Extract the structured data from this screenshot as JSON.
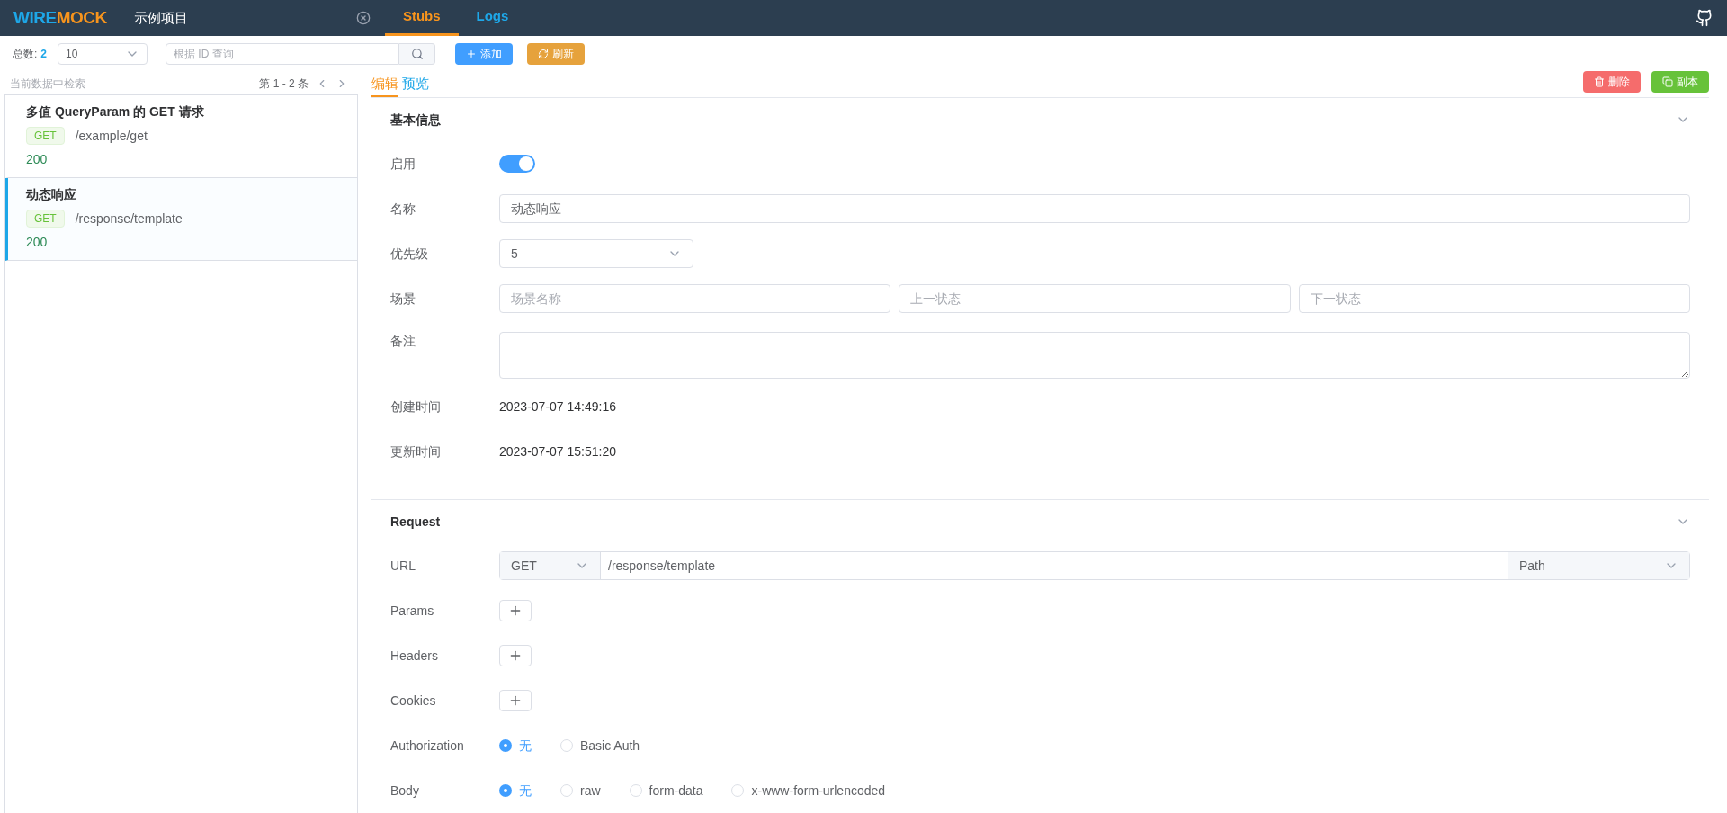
{
  "header": {
    "logo": {
      "first": "WIRE",
      "second": "MOCK"
    },
    "project": "示例项目",
    "tabs": [
      {
        "label": "Stubs",
        "selected": true
      },
      {
        "label": "Logs",
        "selected": false
      }
    ]
  },
  "toolbar": {
    "total_label": "总数:",
    "total": "2",
    "page_size": "10",
    "search": {
      "placeholder": "根据 ID 查询"
    },
    "buttons": [
      {
        "kind": "add",
        "label": "添加"
      },
      {
        "kind": "refresh",
        "label": "刷新"
      }
    ]
  },
  "list": {
    "filter_hint": "当前数据中检索",
    "range": "第 1 - 2 条",
    "items": [
      {
        "title": "多值 QueryParam 的 GET 请求",
        "method": "GET",
        "path": "/example/get",
        "status": "200",
        "selected": false
      },
      {
        "title": "动态响应",
        "method": "GET",
        "path": "/response/template",
        "status": "200",
        "selected": true
      }
    ]
  },
  "detail": {
    "tabs": [
      {
        "label": "编辑",
        "selected": true
      },
      {
        "label": "预览",
        "selected": false
      }
    ],
    "actions": [
      {
        "kind": "delete",
        "label": "删除"
      },
      {
        "kind": "copy",
        "label": "副本"
      }
    ],
    "basic": {
      "title": "基本信息",
      "expanded": true,
      "rows": [
        {
          "kind": "switch",
          "label": "启用",
          "on": true
        },
        {
          "kind": "input",
          "label": "名称",
          "value": "动态响应"
        },
        {
          "kind": "select",
          "label": "优先级",
          "value": "5"
        },
        {
          "kind": "inputs",
          "label": "场景",
          "placeholders": [
            "场景名称",
            "上一状态",
            "下一状态"
          ]
        },
        {
          "kind": "textarea",
          "label": "备注"
        },
        {
          "kind": "text",
          "label": "创建时间",
          "value": "2023-07-07 14:49:16"
        },
        {
          "kind": "text",
          "label": "更新时间",
          "value": "2023-07-07 15:51:20"
        }
      ]
    },
    "request": {
      "title": "Request",
      "expanded": true,
      "rows": [
        {
          "kind": "url",
          "label": "URL",
          "method": "GET",
          "value": "/response/template",
          "match": "Path"
        },
        {
          "kind": "add",
          "label": "Params"
        },
        {
          "kind": "add",
          "label": "Headers"
        },
        {
          "kind": "add",
          "label": "Cookies"
        },
        {
          "kind": "radio",
          "label": "Authorization",
          "options": [
            {
              "label": "无",
              "selected": true
            },
            {
              "label": "Basic Auth",
              "selected": false
            }
          ]
        },
        {
          "kind": "radio",
          "label": "Body",
          "options": [
            {
              "label": "无",
              "selected": true
            },
            {
              "label": "raw",
              "selected": false
            },
            {
              "label": "form-data",
              "selected": false
            },
            {
              "label": "x-www-form-urlencoded",
              "selected": false
            }
          ]
        }
      ]
    }
  }
}
